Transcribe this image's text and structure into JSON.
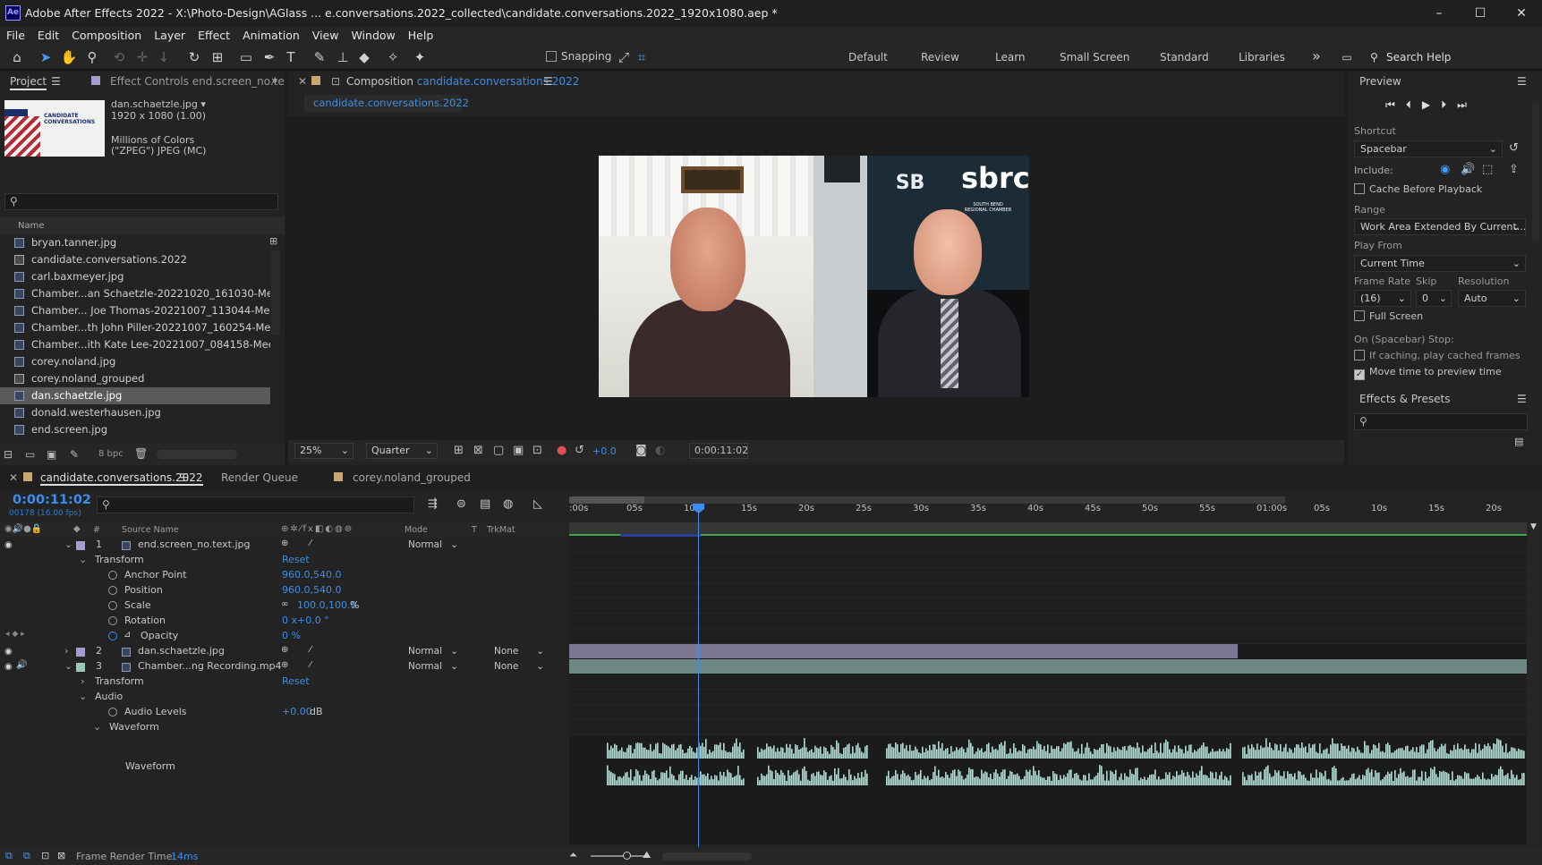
{
  "window": {
    "app_badge": "Ae",
    "title": "Adobe After Effects 2022 - X:\\Photo-Design\\AGlass ... e.conversations.2022_collected\\candidate.conversations.2022_1920x1080.aep *",
    "minimize": "–",
    "maximize": "☐",
    "close": "✕"
  },
  "menu": [
    "File",
    "Edit",
    "Composition",
    "Layer",
    "Effect",
    "Animation",
    "View",
    "Window",
    "Help"
  ],
  "toolbar": {
    "snapping_label": "Snapping",
    "workspaces": [
      "Default",
      "Review",
      "Learn",
      "Small Screen",
      "Standard",
      "Libraries"
    ],
    "search_placeholder": "Search Help",
    "more": "»"
  },
  "project": {
    "tab_label": "Project",
    "effect_controls_label": "Effect Controls end.screen_no.te",
    "selected_name": "dan.schaetzle.jpg ▾",
    "dimensions": "1920 x 1080 (1.00)",
    "color_depth": "Millions of Colors",
    "codec": "(\"ZPEG\") JPEG (MC)",
    "thumb_title": "CANDIDATE CONVERSATIONS",
    "name_header": "Name",
    "items": [
      {
        "name": "bryan.tanner.jpg",
        "selected": false
      },
      {
        "name": "candidate.conversations.2022",
        "selected": false
      },
      {
        "name": "carl.baxmeyer.jpg",
        "selected": false
      },
      {
        "name": "Chamber...an Schaetzle-20221020_161030-Meeting Re",
        "selected": false
      },
      {
        "name": "Chamber... Joe Thomas-20221007_113044-Meeting Re",
        "selected": false
      },
      {
        "name": "Chamber...th John Piller-20221007_160254-Meeting R",
        "selected": false
      },
      {
        "name": "Chamber...ith Kate Lee-20221007_084158-Meeting Re",
        "selected": false
      },
      {
        "name": "corey.noland.jpg",
        "selected": false
      },
      {
        "name": "corey.noland_grouped",
        "selected": false
      },
      {
        "name": "dan.schaetzle.jpg",
        "selected": true
      },
      {
        "name": "donald.westerhausen.jpg",
        "selected": false
      },
      {
        "name": "end.screen.jpg",
        "selected": false
      }
    ],
    "bpc": "8 bpc"
  },
  "composition": {
    "tab_prefix": "Composition",
    "tab_name": "candidate.conversations.2022",
    "subtab": "candidate.conversations.2022",
    "zoom": "25%",
    "resolution": "Quarter",
    "exposure": "+0.0",
    "timecode": "0:00:11:02",
    "logo_small": "SB",
    "logo_big": "sbrc",
    "logo_caption": "SOUTH BEND REGIONAL CHAMBER"
  },
  "preview": {
    "title": "Preview",
    "shortcut_label": "Shortcut",
    "shortcut_value": "Spacebar",
    "include_label": "Include:",
    "cache_before_playback": "Cache Before Playback",
    "range_label": "Range",
    "range_value": "Work Area Extended By Current...",
    "play_from_label": "Play From",
    "play_from_value": "Current Time",
    "frame_rate_label": "Frame Rate",
    "skip_label": "Skip",
    "resolution_label": "Resolution",
    "frame_rate_value": "(16)",
    "skip_value": "0",
    "resolution_value": "Auto",
    "full_screen": "Full Screen",
    "on_stop_label": "On (Spacebar) Stop:",
    "if_caching": "If caching, play cached frames",
    "move_time": "Move time to preview time",
    "move_time_checked": true
  },
  "effects": {
    "title": "Effects & Presets"
  },
  "timeline": {
    "tabs": [
      "candidate.conversations.2022",
      "Render Queue",
      "corey.noland_grouped"
    ],
    "timecode": "0:00:11:02",
    "frames_fps": "00178 (16.00 fps)",
    "headers": {
      "num": "#",
      "source": "Source Name",
      "mode": "Mode",
      "t": "T",
      "trkmat": "TrkMat"
    },
    "ruler": [
      ":00s",
      "05s",
      "10s",
      "15s",
      "20s",
      "25s",
      "30s",
      "35s",
      "40s",
      "45s",
      "50s",
      "55s",
      "01:00s",
      "05s",
      "10s",
      "15s",
      "20s"
    ],
    "layer1": {
      "num": "1",
      "name": "end.screen_no.text.jpg",
      "mode": "Normal"
    },
    "transform": "Transform",
    "reset": "Reset",
    "anchor_label": "Anchor Point",
    "anchor_value": "960.0,540.0",
    "position_label": "Position",
    "position_value": "960.0,540.0",
    "scale_label": "Scale",
    "scale_value": "100.0,100.0",
    "scale_unit": "%",
    "rotation_label": "Rotation",
    "rotation_value": "0 x+0.0 °",
    "opacity_label": "Opacity",
    "opacity_value": "0 %",
    "layer2": {
      "num": "2",
      "name": "dan.schaetzle.jpg",
      "mode": "Normal",
      "trkmat": "None"
    },
    "layer3": {
      "num": "3",
      "name": "Chamber...ng Recording.mp4",
      "mode": "Normal",
      "trkmat": "None"
    },
    "transform2": "Transform",
    "audio": "Audio",
    "audio_levels_label": "Audio Levels",
    "audio_levels_value": "+0.00",
    "audio_levels_unit": "dB",
    "waveform": "Waveform",
    "waveform_sub": "Waveform"
  },
  "status": {
    "frame_render_label": "Frame Render Time:",
    "frame_render_value": "14ms"
  },
  "colors": {
    "accent": "#3b8ef0",
    "layer_purple": "#a69bd2",
    "layer_teal": "#9ec7bc",
    "waveform": "#b6dad2"
  }
}
